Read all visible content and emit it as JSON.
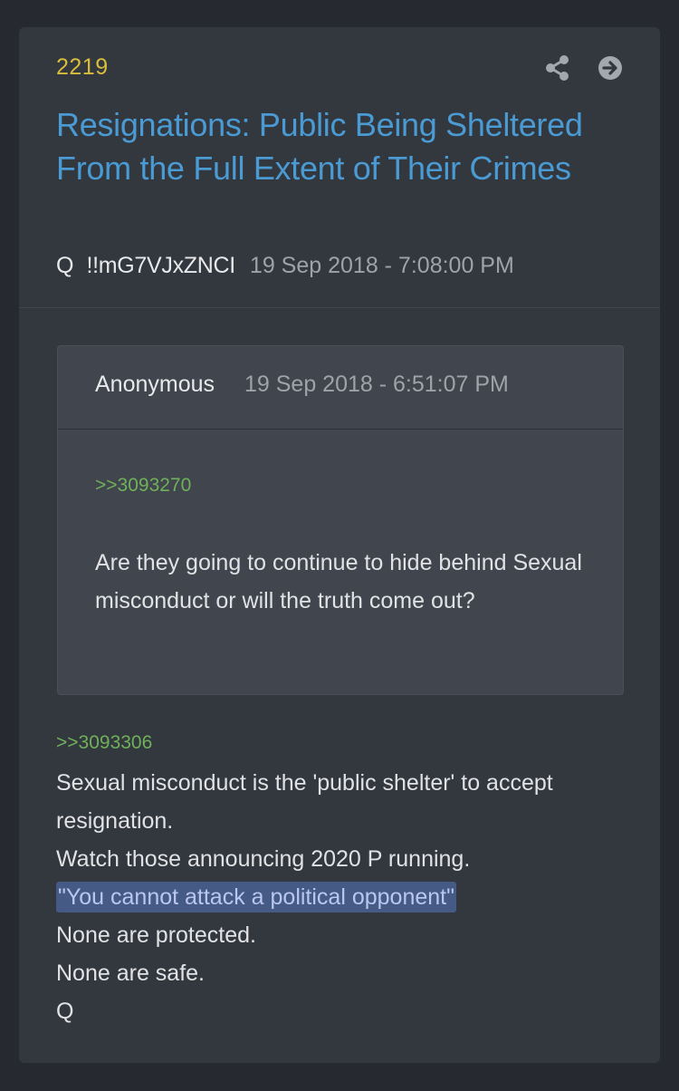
{
  "post": {
    "number": "2219",
    "title": "Resignations: Public Being Sheltered From the Full Extent of Their Crimes",
    "author": "Q",
    "tripcode": "!!mG7VJxZNCI",
    "timestamp": "19 Sep 2018 - 7:08:00 PM",
    "icons": {
      "share": "share-icon",
      "goto": "arrow-right-circle-icon"
    }
  },
  "quote": {
    "author": "Anonymous",
    "timestamp": "19 Sep 2018 - 6:51:07 PM",
    "ref": ">>3093270",
    "text": "Are they going to continue to hide behind Sexual misconduct or will the truth come out?"
  },
  "body": {
    "ref": ">>3093306",
    "lines": [
      "Sexual misconduct is the 'public shelter' to accept",
      "resignation.",
      "Watch those announcing 2020 P running.",
      "\"You cannot attack a political opponent\"",
      "None are protected.",
      "None are safe.",
      "Q"
    ]
  },
  "colors": {
    "number": "#d9be3c",
    "title": "#4a9ad3",
    "ref": "#6fb05b",
    "highlight": "#465a86"
  }
}
